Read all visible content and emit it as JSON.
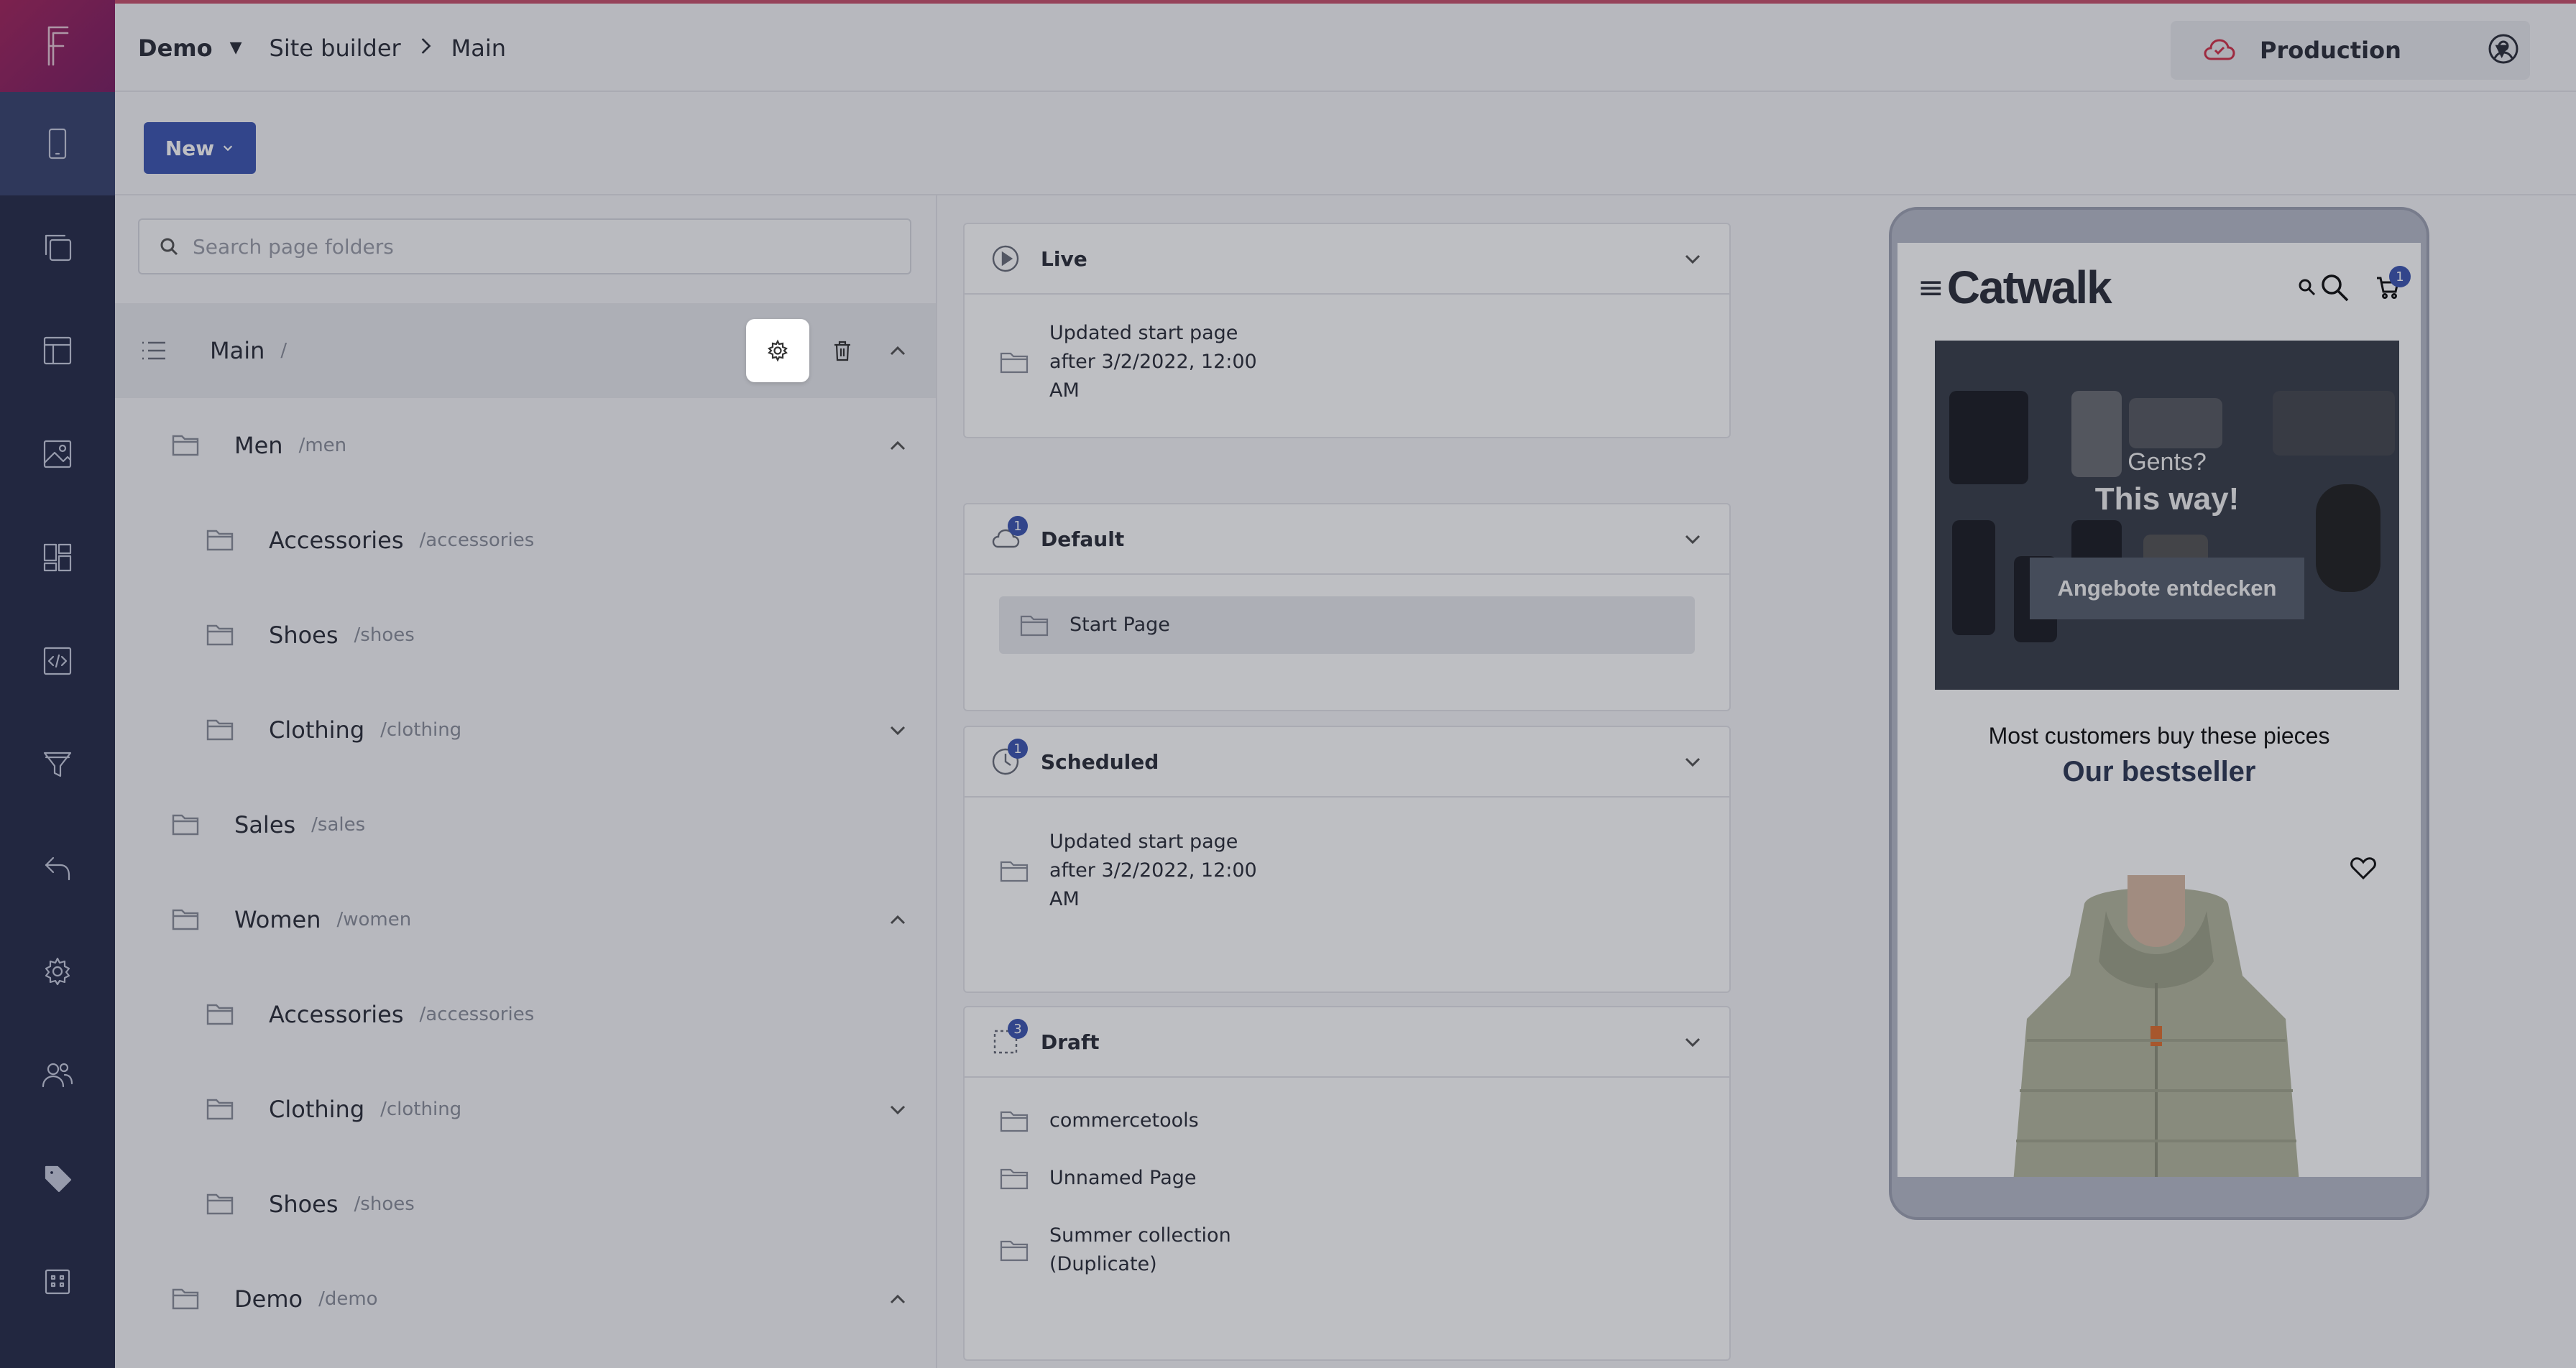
{
  "app": {
    "logo_letter": "F"
  },
  "topbar": {
    "project": "Demo",
    "crumbs": [
      "Site builder",
      "Main"
    ],
    "environment": "Production",
    "env_color": "#d2334a"
  },
  "toolbar": {
    "new_label": "New"
  },
  "tree": {
    "search_placeholder": "Search page folders",
    "root": {
      "name": "Main",
      "path": "/"
    },
    "items": [
      {
        "name": "Men",
        "path": "/men",
        "level": 1,
        "expanded": true
      },
      {
        "name": "Accessories",
        "path": "/accessories",
        "level": 2
      },
      {
        "name": "Shoes",
        "path": "/shoes",
        "level": 2
      },
      {
        "name": "Clothing",
        "path": "/clothing",
        "level": 2,
        "expanded": false
      },
      {
        "name": "Sales",
        "path": "/sales",
        "level": 1
      },
      {
        "name": "Women",
        "path": "/women",
        "level": 1,
        "expanded": true
      },
      {
        "name": "Accessories",
        "path": "/accessories",
        "level": 2
      },
      {
        "name": "Clothing",
        "path": "/clothing",
        "level": 2,
        "expanded": false
      },
      {
        "name": "Shoes",
        "path": "/shoes",
        "level": 2
      },
      {
        "name": "Demo",
        "path": "/demo",
        "level": 1,
        "expanded": true
      }
    ]
  },
  "panels": {
    "live": {
      "title": "Live",
      "entries": [
        "Updated start page\nafter 3/2/2022, 12:00\nAM"
      ]
    },
    "default": {
      "title": "Default",
      "badge": "1",
      "entries": [
        "Start Page"
      ]
    },
    "scheduled": {
      "title": "Scheduled",
      "badge": "1",
      "entries": [
        "Updated start page\nafter 3/2/2022, 12:00\nAM"
      ]
    },
    "draft": {
      "title": "Draft",
      "badge": "3",
      "entries": [
        "commercetools",
        "Unnamed Page",
        "Summer collection\n(Duplicate)"
      ]
    }
  },
  "preview": {
    "brand": "Catwalk",
    "cart_count": "1",
    "hero_kicker": "Gents?",
    "hero_title": "This way!",
    "hero_cta": "Angebote entdecken",
    "section_kicker": "Most customers buy these pieces",
    "section_title": "Our bestseller",
    "accent": "#3d56b2"
  }
}
